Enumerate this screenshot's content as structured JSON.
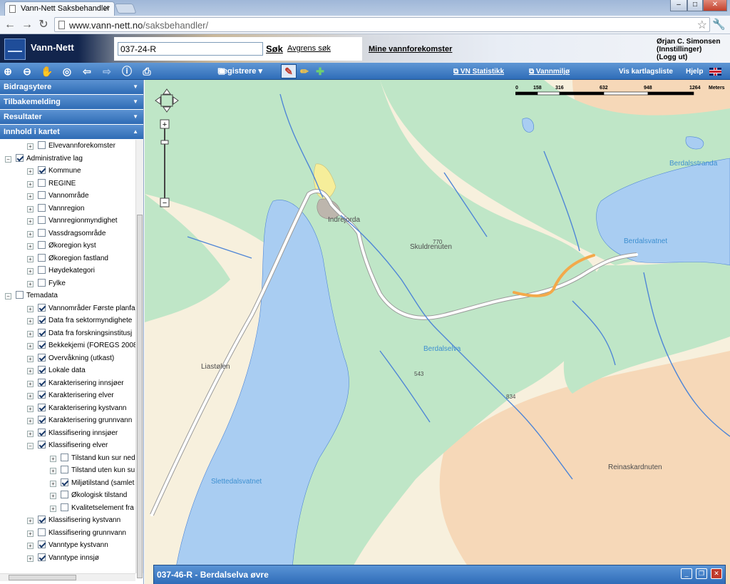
{
  "browser": {
    "tab_title": "Vann-Nett Saksbehandler",
    "url_host": "www.vann-nett.no",
    "url_path": "/saksbehandler/",
    "minimize": "–",
    "maximize": "□",
    "close": "✕"
  },
  "header": {
    "logo_text": "Vann-Nett",
    "search_value": "037-24-R",
    "search_label": "Søk",
    "refine_label": "Avgrens søk",
    "mine_label": "Mine vannforekomster",
    "user_name": "Ørjan C. Simonsen",
    "user_settings": "(Innstillinger)",
    "user_logout": "(Logg ut)"
  },
  "toolbar": {
    "registrere": "Registrere",
    "vn_statistikk": "VN Statistikk",
    "vannmiljo": "Vannmiljø",
    "vis_kartlagsliste": "Vis kartlagsliste",
    "hjelp": "Hjelp"
  },
  "sidebar": {
    "panels": [
      "Bidragsytere",
      "Tilbakemelding",
      "Resultater",
      "Innhold i kartet"
    ],
    "tree": [
      {
        "label": "Elvevannforekomster",
        "level": 2,
        "exp": "+",
        "checked": false
      },
      {
        "label": "Administrative lag",
        "level": 0,
        "exp": "−",
        "checked": true
      },
      {
        "label": "Kommune",
        "level": 2,
        "exp": "+",
        "checked": true
      },
      {
        "label": "REGINE",
        "level": 2,
        "exp": "+",
        "checked": false
      },
      {
        "label": "Vannområde",
        "level": 2,
        "exp": "+",
        "checked": false
      },
      {
        "label": "Vannregion",
        "level": 2,
        "exp": "+",
        "checked": false
      },
      {
        "label": "Vannregionmyndighet",
        "level": 2,
        "exp": "+",
        "checked": false
      },
      {
        "label": "Vassdragsområde",
        "level": 2,
        "exp": "+",
        "checked": false
      },
      {
        "label": "Økoregion kyst",
        "level": 2,
        "exp": "+",
        "checked": false
      },
      {
        "label": "Økoregion fastland",
        "level": 2,
        "exp": "+",
        "checked": false
      },
      {
        "label": "Høydekategori",
        "level": 2,
        "exp": "+",
        "checked": false
      },
      {
        "label": "Fylke",
        "level": 2,
        "exp": "+",
        "checked": false
      },
      {
        "label": "Temadata",
        "level": 0,
        "exp": "−",
        "checked": false
      },
      {
        "label": "Vannområder Første planfa",
        "level": 2,
        "exp": "+",
        "checked": true
      },
      {
        "label": "Data fra sektormyndighete",
        "level": 2,
        "exp": "+",
        "checked": true
      },
      {
        "label": "Data fra forskningsinstitusj",
        "level": 2,
        "exp": "+",
        "checked": true
      },
      {
        "label": "Bekkekjemi (FOREGS 2008",
        "level": 2,
        "exp": "+",
        "checked": true
      },
      {
        "label": "Overvåkning (utkast)",
        "level": 2,
        "exp": "+",
        "checked": true
      },
      {
        "label": "Lokale data",
        "level": 2,
        "exp": "+",
        "checked": true
      },
      {
        "label": "Karakterisering innsjøer",
        "level": 2,
        "exp": "+",
        "checked": true
      },
      {
        "label": "Karakterisering elver",
        "level": 2,
        "exp": "+",
        "checked": true
      },
      {
        "label": "Karakterisering kystvann",
        "level": 2,
        "exp": "+",
        "checked": true
      },
      {
        "label": "Karakterisering grunnvann",
        "level": 2,
        "exp": "+",
        "checked": true
      },
      {
        "label": "Klassifisering innsjøer",
        "level": 2,
        "exp": "+",
        "checked": true
      },
      {
        "label": "Klassifisering elver",
        "level": 2,
        "exp": "−",
        "checked": true
      },
      {
        "label": "Tilstand kun sur ned",
        "level": 4,
        "exp": "+",
        "checked": false
      },
      {
        "label": "Tilstand uten kun su",
        "level": 4,
        "exp": "+",
        "checked": false
      },
      {
        "label": "Miljøtilstand (samlet",
        "level": 4,
        "exp": "+",
        "checked": true
      },
      {
        "label": "Økologisk tilstand",
        "level": 4,
        "exp": "+",
        "checked": false
      },
      {
        "label": "Kvalitetselement fra",
        "level": 4,
        "exp": "+",
        "checked": false
      },
      {
        "label": "Klassifisering kystvann",
        "level": 2,
        "exp": "+",
        "checked": true
      },
      {
        "label": "Klassifisering grunnvann",
        "level": 2,
        "exp": "+",
        "checked": false
      },
      {
        "label": "Vanntype kystvann",
        "level": 2,
        "exp": "+",
        "checked": true
      },
      {
        "label": "Vanntype innsjø",
        "level": 2,
        "exp": "+",
        "checked": true
      }
    ]
  },
  "map": {
    "scale": {
      "labels": [
        "0",
        "158",
        "316",
        "632",
        "948",
        "1264"
      ],
      "unit": "Meters"
    },
    "places": [
      {
        "id": "berdalsstranda",
        "text": "Berdalsstranda",
        "water": true
      },
      {
        "id": "berdalsvatnet",
        "text": "Berdalsvatnet",
        "water": true
      },
      {
        "id": "indrejorda",
        "text": "Indrejorda",
        "water": false
      },
      {
        "id": "skuldrenuten",
        "text": "Skuldrenuten",
        "water": false
      },
      {
        "id": "elev770",
        "text": "770",
        "water": false
      },
      {
        "id": "berdalselva",
        "text": "Berdalselva",
        "water": true
      },
      {
        "id": "liastolen",
        "text": "Liastølen",
        "water": false
      },
      {
        "id": "elev543",
        "text": "543",
        "water": false
      },
      {
        "id": "elev834",
        "text": "834",
        "water": false
      },
      {
        "id": "slettedalsvatnet",
        "text": "Slettedalsvatnet",
        "water": true
      },
      {
        "id": "reinaskardnuten",
        "text": "Reinaskardnuten",
        "water": false
      }
    ],
    "colors": {
      "water": "#a9cdf2",
      "forest": "#bfe6c7",
      "open": "#f7f0dd",
      "bare": "#f6d8b8",
      "river": "#4f86d6",
      "selected": "#f3a94a"
    }
  },
  "bottom_panel": {
    "title": "037-46-R - Berdalselva øvre"
  }
}
